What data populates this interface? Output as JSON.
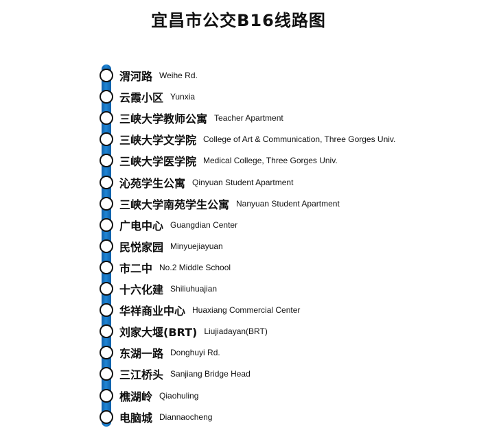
{
  "title": "宜昌市公交B16线路图",
  "colors": {
    "route_line": "#1f86d6",
    "stop_border": "#111111",
    "stop_fill": "#ffffff"
  },
  "stops": [
    {
      "cn": "渭河路",
      "en": "Weihe Rd."
    },
    {
      "cn": "云霞小区",
      "en": "Yunxia"
    },
    {
      "cn": "三峡大学教师公寓",
      "en": "Teacher Apartment"
    },
    {
      "cn": "三峡大学文学院",
      "en": "College of Art & Communication, Three Gorges Univ."
    },
    {
      "cn": "三峡大学医学院",
      "en": "Medical College, Three Gorges Univ."
    },
    {
      "cn": "沁苑学生公寓",
      "en": "Qinyuan Student Apartment"
    },
    {
      "cn": "三峡大学南苑学生公寓",
      "en": "Nanyuan Student Apartment"
    },
    {
      "cn": "广电中心",
      "en": "Guangdian Center"
    },
    {
      "cn": "民悦家园",
      "en": "Minyuejiayuan"
    },
    {
      "cn": "市二中",
      "en": "No.2 Middle School"
    },
    {
      "cn": "十六化建",
      "en": "Shiliuhuajian"
    },
    {
      "cn": "华祥商业中心",
      "en": "Huaxiang Commercial Center"
    },
    {
      "cn": "刘家大堰(BRT)",
      "en": "Liujiadayan(BRT)"
    },
    {
      "cn": "东湖一路",
      "en": "Donghuyi Rd."
    },
    {
      "cn": "三江桥头",
      "en": "Sanjiang Bridge Head"
    },
    {
      "cn": "樵湖岭",
      "en": "Qiaohuling"
    },
    {
      "cn": "电脑城",
      "en": "Diannaocheng"
    }
  ]
}
